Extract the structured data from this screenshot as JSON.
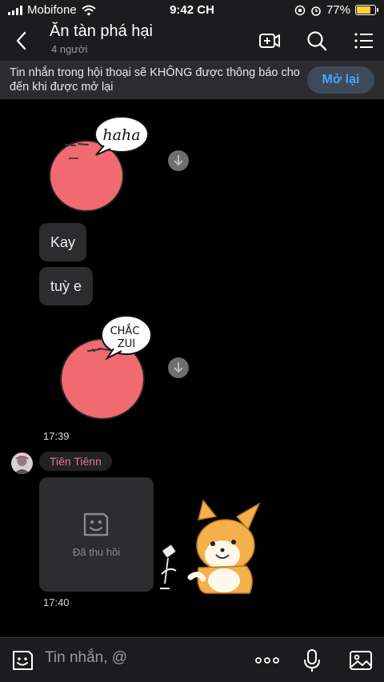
{
  "status": {
    "carrier": "Mobifone",
    "time": "9:42 CH",
    "battery": "77%",
    "battery_fill": 0.77
  },
  "header": {
    "title": "Ăn tàn phá hại",
    "subtitle": "4 người"
  },
  "banner": {
    "text": "Tin nhắn trong hội thoại sẽ KHÔNG được thông báo cho đến khi được mở lại",
    "button": "Mở lại"
  },
  "messages": {
    "sticker1_text": "haha",
    "bubble1": "Kay",
    "bubble2": "tuỳ e",
    "sticker2_text_line1": "CHẮC",
    "sticker2_text_line2": "ZUI",
    "time1": "17:39",
    "sender": "Tiên Tiênn",
    "recalled": "Đã thu hồi",
    "time2": "17:40"
  },
  "input": {
    "placeholder": "Tin nhắn, @"
  },
  "colors": {
    "accent": "#4aa3ff",
    "sender": "#e07a8c",
    "blob": "#f06a6f"
  }
}
